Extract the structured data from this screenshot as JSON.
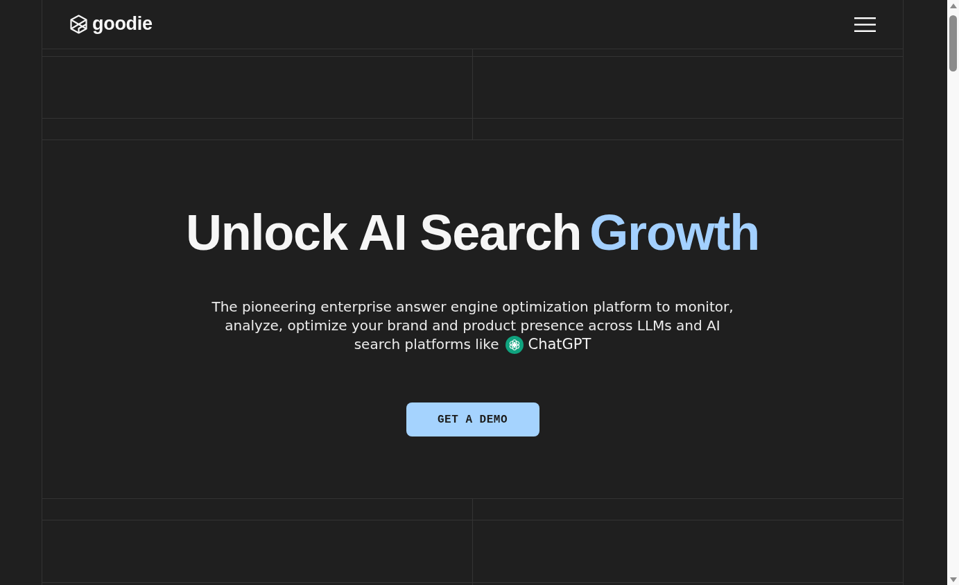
{
  "header": {
    "logo": {
      "text": "goodie"
    }
  },
  "hero": {
    "title": [
      {
        "text": "Unlock AI Search",
        "highlight": false
      },
      {
        "text": "Growth",
        "highlight": true
      }
    ],
    "subtitle": "The pioneering enterprise answer engine optimization platform to monitor, analyze, optimize your brand and product presence across LLMs and AI search platforms like",
    "platform": {
      "name": "ChatGPT"
    },
    "cta": {
      "label": "GET A DEMO"
    }
  }
}
